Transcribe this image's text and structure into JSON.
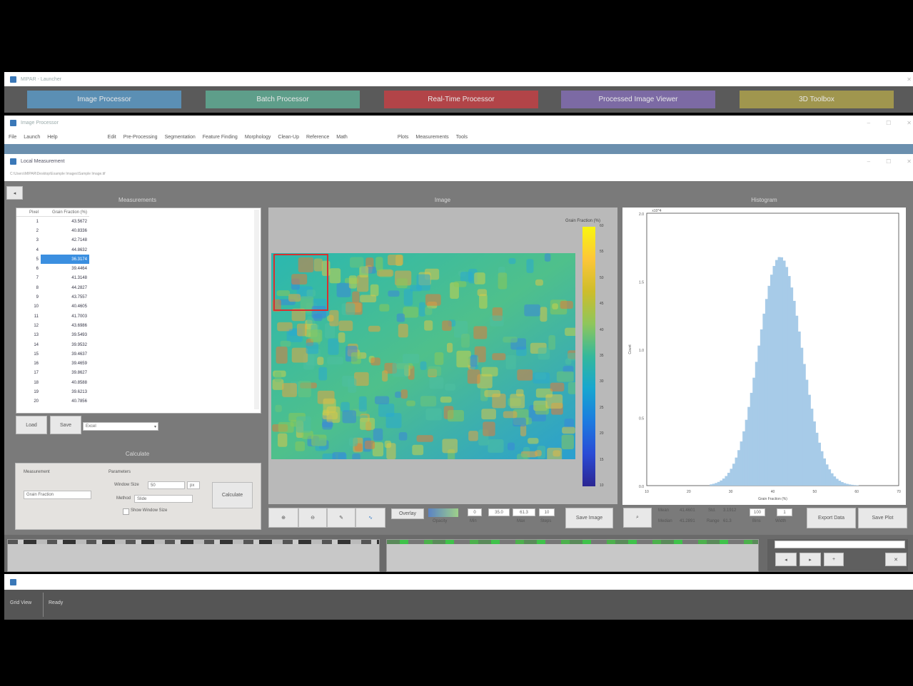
{
  "launcher_window": {
    "title": "MIPAR - Launcher"
  },
  "launcher_buttons": [
    {
      "label": "Image Processor",
      "color": "#5b8fb4"
    },
    {
      "label": "Batch Processor",
      "color": "#5e9e8a"
    },
    {
      "label": "Real-Time Processor",
      "color": "#b24448"
    },
    {
      "label": "Processed Image Viewer",
      "color": "#7c6aa4"
    },
    {
      "label": "3D Toolbox",
      "color": "#a0964e"
    }
  ],
  "processor_window": {
    "title": "Image Processor"
  },
  "menu": {
    "left": [
      "File",
      "Launch",
      "Help"
    ],
    "center": [
      "Edit",
      "Pre-Processing",
      "Segmentation",
      "Feature Finding",
      "Morphology",
      "Clean-Up",
      "Reference",
      "Math"
    ],
    "right": [
      "Plots",
      "Measurements",
      "Tools"
    ]
  },
  "local_window": {
    "title": "Local Measurement",
    "path": "C:\\Users\\MIPAR\\Desktop\\Example Images\\Sample Image.tif"
  },
  "measurements": {
    "title": "Measurements",
    "columns": [
      "Pixel",
      "Grain Fraction (%)"
    ],
    "selected_row": 4,
    "rows": [
      [
        "1",
        "43.5672"
      ],
      [
        "2",
        "40.8336"
      ],
      [
        "3",
        "42.7148"
      ],
      [
        "4",
        "44.8632"
      ],
      [
        "5",
        "36.3174"
      ],
      [
        "6",
        "39.4464"
      ],
      [
        "7",
        "41.3148"
      ],
      [
        "8",
        "44.2827"
      ],
      [
        "9",
        "43.7557"
      ],
      [
        "10",
        "40.4605"
      ],
      [
        "11",
        "41.7003"
      ],
      [
        "12",
        "43.6986"
      ],
      [
        "13",
        "39.5493"
      ],
      [
        "14",
        "39.9532"
      ],
      [
        "15",
        "39.4637"
      ],
      [
        "16",
        "39.4659"
      ],
      [
        "17",
        "39.8627"
      ],
      [
        "18",
        "40.8588"
      ],
      [
        "19",
        "39.6213"
      ],
      [
        "20",
        "40.7856"
      ]
    ],
    "load_label": "Load",
    "save_label": "Save",
    "format_value": "Excel"
  },
  "calculate": {
    "title": "Calculate",
    "measurement_label": "Measurement",
    "measurement_value": "Grain Fraction",
    "parameters_label": "Parameters",
    "window_size_label": "Window Size",
    "window_size_value": "50",
    "window_unit": "px",
    "method_label": "Method",
    "method_value": "Slide",
    "show_window_label": "Show Window Size",
    "button": "Calculate"
  },
  "image_panel": {
    "title": "Image",
    "colorbar_label": "Grain Fraction (%)",
    "colorbar_ticks": [
      "60",
      "55",
      "50",
      "45",
      "40",
      "35",
      "30",
      "25",
      "20",
      "15",
      "10"
    ],
    "overlay_label": "Overlay",
    "opacity_label": "Opacity",
    "min_value": "0",
    "min_label": "Min",
    "mid_value": "35.0",
    "max_value": "61.3",
    "max_label": "Max",
    "step_value": "10",
    "step_label": "Steps",
    "save_image": "Save Image"
  },
  "histogram": {
    "title": "Histogram",
    "xlabel": "Grain Fraction (%)",
    "ylabel": "Count",
    "yticks": [
      "2.0",
      "1.5",
      "1.0",
      "0.5",
      "0.0"
    ],
    "xticks": [
      "10",
      "20",
      "30",
      "40",
      "50",
      "60",
      "70"
    ],
    "multiplier": "x10^4",
    "mean_label": "Mean",
    "mean_value": "41.4601",
    "std_label": "Std.",
    "std_value": "3.1912",
    "median_label": "Median",
    "median_value": "41.2891",
    "range_label": "Range",
    "range_value": "61.3",
    "bins_label": "Bins",
    "bins_value": "100",
    "width_label": "Width",
    "width_value": "1",
    "export_data": "Export Data",
    "save_plot": "Save Plot"
  },
  "status": {
    "left": "Grid View",
    "right": "Ready"
  }
}
